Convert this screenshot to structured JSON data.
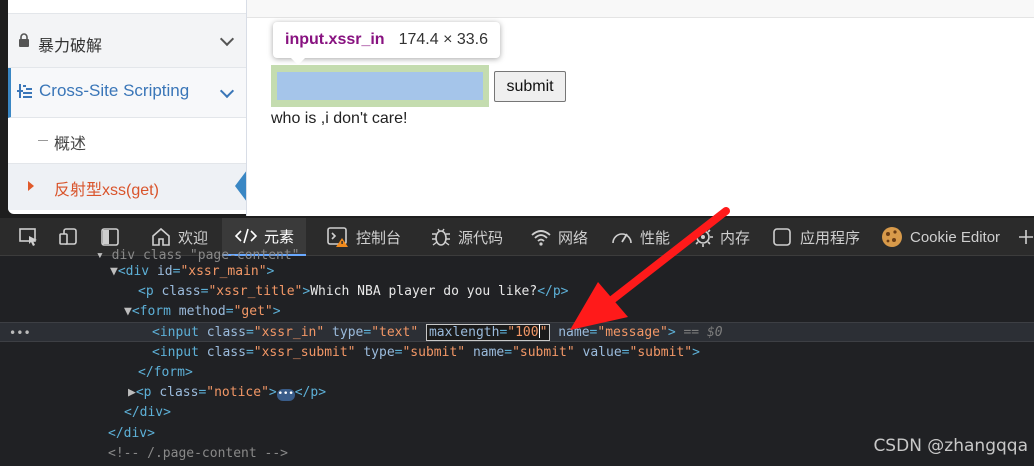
{
  "sidebar": {
    "items": [
      {
        "label": "暴力破解",
        "icon": "lock-icon"
      },
      {
        "label": "Cross-Site Scripting",
        "icon": "tree-icon"
      },
      {
        "label": "概述"
      },
      {
        "label": "反射型xss(get)"
      }
    ]
  },
  "main": {
    "tooltip": {
      "selector": "input.xssr_in",
      "dimensions": "174.4 × 33.6"
    },
    "submit_label": "submit",
    "notice": "who is ,i don't care!"
  },
  "devtools": {
    "tabs": [
      {
        "label": "欢迎",
        "icon": "home-icon"
      },
      {
        "label": "元素",
        "icon": "code-icon"
      },
      {
        "label": "控制台",
        "icon": "console-icon"
      },
      {
        "label": "源代码",
        "icon": "bug-icon"
      },
      {
        "label": "网络",
        "icon": "wifi-icon"
      },
      {
        "label": "性能",
        "icon": "gauge-icon"
      },
      {
        "label": "内存",
        "icon": "gear-icon"
      },
      {
        "label": "应用程序",
        "icon": "app-icon"
      },
      {
        "label": "Cookie Editor",
        "icon": "cookie-icon"
      }
    ],
    "dom_lines": [
      {
        "text": "▾ <div class=\"page-content\">"
      },
      {
        "text": "<div id=\"xssr_main\">"
      },
      {
        "text": "<p class=\"xssr_title\">Which NBA player do you like?</p>"
      },
      {
        "text": "<form method=\"get\">"
      },
      {
        "text": "<input class=\"xssr_in\" type=\"text\" maxlength=\"100\" name=\"message\"> == $0"
      },
      {
        "text": "<input class=\"xssr_submit\" type=\"submit\" name=\"submit\" value=\"submit\">"
      },
      {
        "text": "</form>"
      },
      {
        "text": "<p class=\"notice\">…</p>"
      },
      {
        "text": "</div>"
      },
      {
        "text": "</div>"
      },
      {
        "text": "<!-- /.page-content -->"
      }
    ],
    "tokens": {
      "t_div": "div",
      "t_p": "p",
      "t_form": "form",
      "t_input": "input",
      "a_id": "id",
      "v_xssr_main": "\"xssr_main\"",
      "a_class": "class",
      "v_xssr_title": "\"xssr_title\"",
      "title_text": "Which NBA player do you like?",
      "a_method": "method",
      "v_get": "\"get\"",
      "v_xssr_in": "\"xssr_in\"",
      "a_type": "type",
      "v_text": "\"text\"",
      "a_maxlength": "maxlength",
      "v_100": "\"100",
      "a_name": "name",
      "v_message": "\"message\"",
      "eq0": "== $0",
      "v_xssr_submit": "\"xssr_submit\"",
      "v_submit_type": "\"submit\"",
      "v_submit_name": "\"submit\"",
      "a_value": "value",
      "v_submit_value": "\"submit\"",
      "v_notice": "\"notice\"",
      "comment": "<!-- /.page-content -->",
      "partial_top": "div class \"page-content\""
    }
  },
  "watermark": "CSDN @zhangqqa",
  "colors": {
    "accent": "#3a87c4",
    "active_nav": "#d9542b",
    "arrow": "#ff1a1a"
  }
}
